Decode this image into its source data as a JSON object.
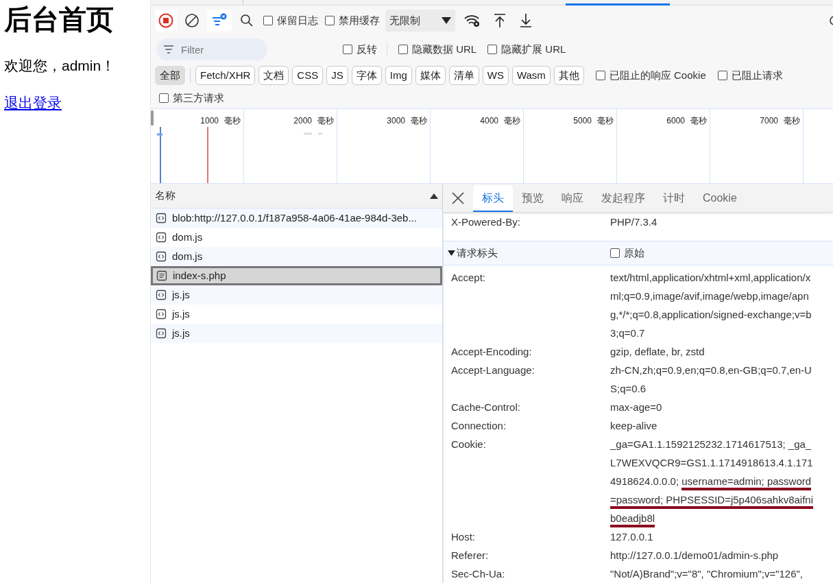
{
  "page": {
    "heading": "后台首页",
    "welcome": "欢迎您，admin！",
    "logout_link": "退出登录"
  },
  "toolbar": {
    "options": [
      {
        "label": "保留日志",
        "checked": false
      },
      {
        "label": "禁用缓存",
        "checked": false
      }
    ],
    "throttling": "无限制"
  },
  "filter": {
    "placeholder": "Filter",
    "options": [
      {
        "label": "反转",
        "checked": false
      },
      {
        "label": "隐藏数据 URL",
        "checked": false
      },
      {
        "label": "隐藏扩展 URL",
        "checked": false
      }
    ]
  },
  "types": [
    {
      "label": "全部",
      "selected": true
    },
    {
      "label": "Fetch/XHR",
      "selected": false
    },
    {
      "label": "文档",
      "selected": false
    },
    {
      "label": "CSS",
      "selected": false
    },
    {
      "label": "JS",
      "selected": false
    },
    {
      "label": "字体",
      "selected": false
    },
    {
      "label": "Img",
      "selected": false
    },
    {
      "label": "媒体",
      "selected": false
    },
    {
      "label": "清单",
      "selected": false
    },
    {
      "label": "WS",
      "selected": false
    },
    {
      "label": "Wasm",
      "selected": false
    },
    {
      "label": "其他",
      "selected": false
    }
  ],
  "type_options": [
    {
      "label": "已阻止的响应 Cookie",
      "checked": false
    },
    {
      "label": "已阻止请求",
      "checked": false
    },
    {
      "label": "第三方请求",
      "checked": false
    }
  ],
  "timeline": {
    "ticks": [
      {
        "value": "1000",
        "unit": "毫秒"
      },
      {
        "value": "2000",
        "unit": "毫秒"
      },
      {
        "value": "3000",
        "unit": "毫秒"
      },
      {
        "value": "4000",
        "unit": "毫秒"
      },
      {
        "value": "5000",
        "unit": "毫秒"
      },
      {
        "value": "6000",
        "unit": "毫秒"
      },
      {
        "value": "7000",
        "unit": "毫秒"
      }
    ]
  },
  "requests": {
    "column": "名称",
    "rows": [
      {
        "name": "blob:http://127.0.0.1/f187a958-4a06-41ae-984d-3eb...",
        "kind": "script",
        "selected": false
      },
      {
        "name": "dom.js",
        "kind": "script",
        "selected": false
      },
      {
        "name": "dom.js",
        "kind": "script",
        "selected": false
      },
      {
        "name": "index-s.php",
        "kind": "document",
        "selected": true
      },
      {
        "name": "js.js",
        "kind": "script",
        "selected": false
      },
      {
        "name": "js.js",
        "kind": "script",
        "selected": false
      },
      {
        "name": "js.js",
        "kind": "script",
        "selected": false
      }
    ]
  },
  "details": {
    "tabs": [
      {
        "label": "标头",
        "selected": true
      },
      {
        "label": "预览",
        "selected": false
      },
      {
        "label": "响应",
        "selected": false
      },
      {
        "label": "发起程序",
        "selected": false
      },
      {
        "label": "计时",
        "selected": false
      },
      {
        "label": "Cookie",
        "selected": false
      }
    ],
    "response_headers": [
      {
        "name": "X-Powered-By:",
        "value": [
          {
            "text": "PHP/7.3.4",
            "underlined": false
          }
        ]
      }
    ],
    "section": {
      "title": "请求标头",
      "expanded": true,
      "raw_label": "原始",
      "raw_checked": false
    },
    "request_headers": [
      {
        "name": "Accept:",
        "value": [
          {
            "text": "text/html,application/xhtml+xml,application/xml;q=0.9,image/avif,image/webp,image/apng,*/*;q=0.8,application/signed-exchange;v=b3;q=0.7",
            "underlined": false
          }
        ]
      },
      {
        "name": "Accept-Encoding:",
        "value": [
          {
            "text": "gzip, deflate, br, zstd",
            "underlined": false
          }
        ]
      },
      {
        "name": "Accept-Language:",
        "value": [
          {
            "text": "zh-CN,zh;q=0.9,en;q=0.8,en-GB;q=0.7,en-US;q=0.6",
            "underlined": false
          }
        ]
      },
      {
        "name": "Cache-Control:",
        "value": [
          {
            "text": "max-age=0",
            "underlined": false
          }
        ]
      },
      {
        "name": "Connection:",
        "value": [
          {
            "text": "keep-alive",
            "underlined": false
          }
        ]
      },
      {
        "name": "Cookie:",
        "value": [
          {
            "text": "_ga=GA1.1.1592125232.1714617513; _ga_L7WEXVQCR9=GS1.1.1714918613.4.1.1714918624.0.0.0; ",
            "underlined": false
          },
          {
            "text": "username=admin; ",
            "underlined": true
          },
          {
            "text": "password=password; ",
            "underlined": true
          },
          {
            "text": "PHPSESSID=j5p406sahkv8aifnib0eadjb8l",
            "underlined": true
          }
        ]
      },
      {
        "name": "Host:",
        "value": [
          {
            "text": "127.0.0.1",
            "underlined": false
          }
        ]
      },
      {
        "name": "Referer:",
        "value": [
          {
            "text": "http://127.0.0.1/demo01/admin-s.php",
            "underlined": false
          }
        ]
      },
      {
        "name": "Sec-Ch-Ua:",
        "value": [
          {
            "text": "\"Not/A)Brand\";v=\"8\", \"Chromium\";v=\"126\",",
            "underlined": false
          }
        ]
      }
    ]
  }
}
